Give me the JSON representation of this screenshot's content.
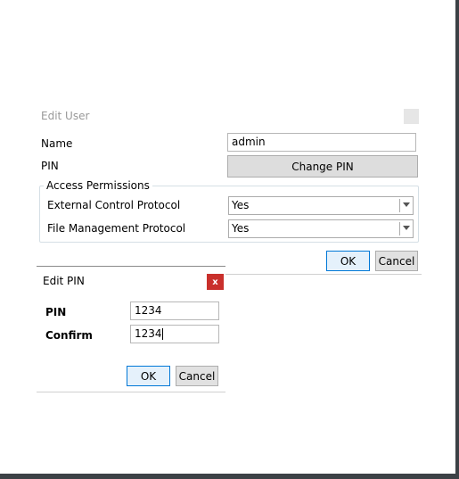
{
  "edit_user": {
    "title": "Edit User",
    "name_label": "Name",
    "name_value": "admin",
    "pin_label": "PIN",
    "change_pin_label": "Change PIN",
    "permissions_legend": "Access Permissions",
    "permissions": [
      {
        "label": "External Control Protocol",
        "value": "Yes"
      },
      {
        "label": "File Management Protocol",
        "value": "Yes"
      }
    ],
    "ok_label": "OK",
    "cancel_label": "Cancel"
  },
  "edit_pin": {
    "title": "Edit PIN",
    "close_label": "x",
    "pin_label": "PIN",
    "pin_value": "1234",
    "confirm_label": "Confirm",
    "confirm_value": "1234",
    "ok_label": "OK",
    "cancel_label": "Cancel"
  },
  "colors": {
    "frame": "#3c4146",
    "close_button": "#c9302c",
    "default_button_border": "#0078d7"
  },
  "icons": {
    "combo_arrow": "chevron-down-icon",
    "edit_user_close": "close-icon",
    "edit_pin_close": "close-icon"
  }
}
